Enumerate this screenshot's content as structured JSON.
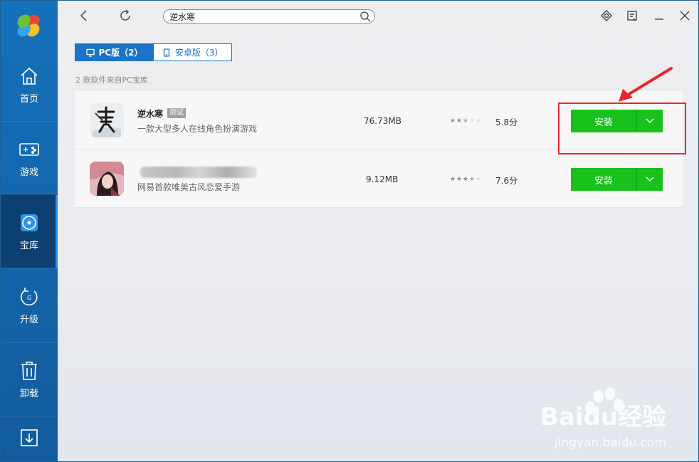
{
  "search": {
    "value": "逆水寒"
  },
  "sidebar": {
    "items": [
      {
        "label": "首页",
        "icon": "home-icon"
      },
      {
        "label": "游戏",
        "icon": "gamepad-icon"
      },
      {
        "label": "宝库",
        "icon": "disc-icon",
        "active": true
      },
      {
        "label": "升级",
        "icon": "upgrade-icon"
      },
      {
        "label": "卸载",
        "icon": "trash-icon"
      },
      {
        "label": "",
        "icon": "download-icon"
      }
    ]
  },
  "tabs": [
    {
      "label": "PC版（2）",
      "active": true
    },
    {
      "label": "安卓版（3）",
      "active": false
    }
  ],
  "count_line": "2 款软件来自PC宝库",
  "apps": [
    {
      "name": "逆水寒",
      "badge": "测试",
      "desc": "一款大型多人在线角色扮演游戏",
      "size": "76.73MB",
      "rating": 2.5,
      "score": "5.8分",
      "install_label": "安装"
    },
    {
      "name": "",
      "badge": "",
      "desc": "网易首款唯美古风恋爱手游",
      "size": "9.12MB",
      "rating": 3.5,
      "score": "7.6分",
      "install_label": "安装"
    }
  ],
  "watermark": {
    "main": "Baidu经验",
    "sub": "jingyan.baidu.com"
  },
  "colors": {
    "sidebar": "#1570bb",
    "accent": "#1a73c7",
    "install": "#19c11c",
    "highlight": "#e8262a"
  }
}
